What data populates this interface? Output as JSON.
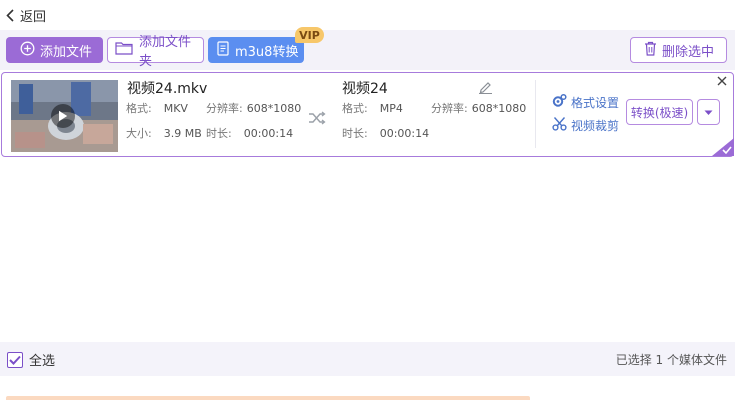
{
  "topbar": {
    "back_label": "返回"
  },
  "toolbar": {
    "add_file_label": "添加文件",
    "add_folder_label": "添加文件夹",
    "m3u8_label": "m3u8转换",
    "vip_label": "VIP",
    "delete_selected_label": "删除选中"
  },
  "file": {
    "source": {
      "name": "视频24.mkv",
      "format_key": "格式:",
      "format": "MKV",
      "resolution_key": "分辨率:",
      "resolution": "608*1080",
      "size_key": "大小:",
      "size": "3.9 MB",
      "duration_key": "时长:",
      "duration": "00:00:14"
    },
    "output": {
      "name": "视频24",
      "format_key": "格式:",
      "format": "MP4",
      "resolution_key": "分辨率:",
      "resolution": "608*1080",
      "duration_key": "时长:",
      "duration": "00:00:14"
    },
    "format_settings_label": "格式设置",
    "video_crop_label": "视频裁剪",
    "convert_label": "转换(极速)"
  },
  "footer": {
    "select_all_label": "全选",
    "selection_status": "已选择 1 个媒体文件"
  },
  "colors": {
    "accent_purple": "#9b6bd6",
    "accent_blue": "#5b8ef0",
    "vip_gold": "#f7c76a",
    "link_blue": "#4a73c8"
  },
  "icons": [
    "back-arrow-icon",
    "plus-circle-icon",
    "folder-icon",
    "document-icon",
    "trash-icon",
    "play-icon",
    "shuffle-icon",
    "pencil-icon",
    "gear-icon",
    "scissors-icon",
    "chevron-down-icon",
    "close-icon",
    "check-icon"
  ]
}
